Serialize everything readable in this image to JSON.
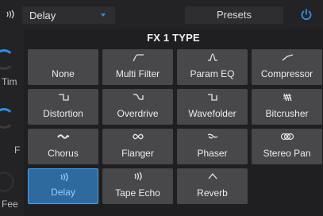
{
  "topbar": {
    "fx_slot_value": "Delay",
    "presets_label": "Presets",
    "accent_color": "#2e8fe8"
  },
  "left_strip": {
    "labels": [
      "Tim",
      "F",
      "Fee"
    ]
  },
  "panel": {
    "title": "FX 1 TYPE",
    "tiles": [
      {
        "label": "None",
        "icon": "none",
        "selected": false
      },
      {
        "label": "Multi Filter",
        "icon": "filter-curve-icon",
        "selected": false
      },
      {
        "label": "Param EQ",
        "icon": "eq-peak-icon",
        "selected": false
      },
      {
        "label": "Compressor",
        "icon": "compressor-curve-icon",
        "selected": false
      },
      {
        "label": "Distortion",
        "icon": "distortion-wave-icon",
        "selected": false
      },
      {
        "label": "Overdrive",
        "icon": "overdrive-wave-icon",
        "selected": false
      },
      {
        "label": "Wavefolder",
        "icon": "wavefolder-wave-icon",
        "selected": false
      },
      {
        "label": "Bitcrusher",
        "icon": "bitcrusher-icon",
        "selected": false
      },
      {
        "label": "Chorus",
        "icon": "chorus-icon",
        "selected": false
      },
      {
        "label": "Flanger",
        "icon": "flanger-icon",
        "selected": false
      },
      {
        "label": "Phaser",
        "icon": "phaser-icon",
        "selected": false
      },
      {
        "label": "Stereo Pan",
        "icon": "stereo-pan-icon",
        "selected": false
      },
      {
        "label": "Delay",
        "icon": "delay-icon",
        "selected": true
      },
      {
        "label": "Tape Echo",
        "icon": "tape-echo-icon",
        "selected": false
      },
      {
        "label": "Reverb",
        "icon": "reverb-icon",
        "selected": false
      }
    ]
  }
}
